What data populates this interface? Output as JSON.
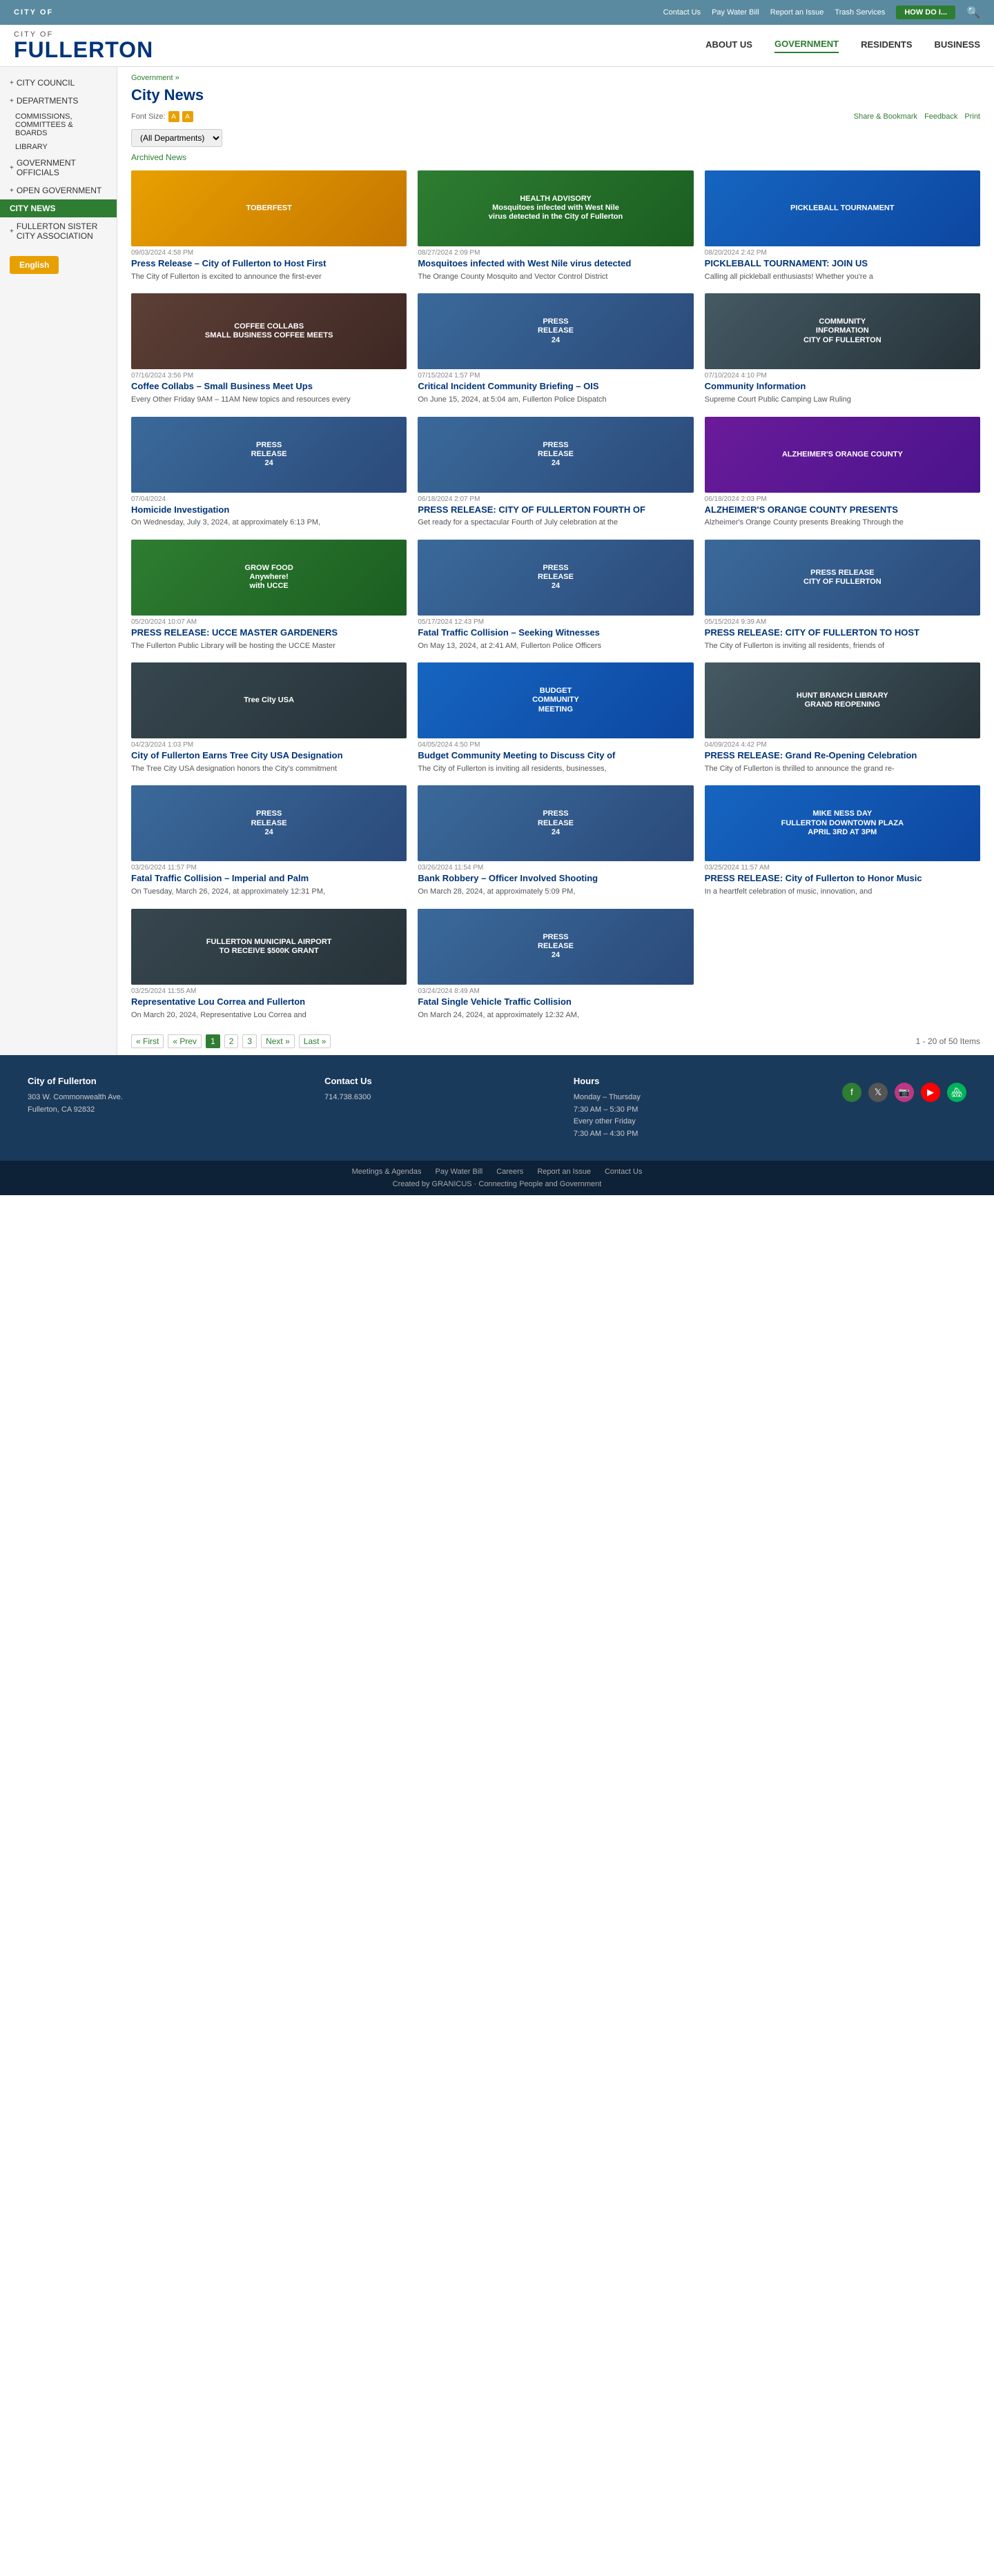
{
  "topbar": {
    "city_of": "CITY OF",
    "links": [
      "Contact Us",
      "Pay Water Bill",
      "Report an Issue",
      "Trash Services"
    ],
    "how_do_i": "HOW DO I...",
    "search_icon": "🔍"
  },
  "header": {
    "city_of": "CITY OF",
    "fullerton": "FULLERTON",
    "nav": [
      {
        "label": "ABOUT US",
        "active": false
      },
      {
        "label": "GOVERNMENT",
        "active": true
      },
      {
        "label": "RESIDENTS",
        "active": false
      },
      {
        "label": "BUSINESS",
        "active": false
      }
    ]
  },
  "sidebar": {
    "items": [
      {
        "label": "CITY COUNCIL",
        "expandable": true
      },
      {
        "label": "DEPARTMENTS",
        "expandable": true
      },
      {
        "label": "COMMISSIONS, COMMITTEES & BOARDS",
        "sub": true
      },
      {
        "label": "LIBRARY",
        "sub": true
      },
      {
        "label": "GOVERNMENT OFFICIALS",
        "expandable": true
      },
      {
        "label": "OPEN GOVERNMENT",
        "expandable": true
      },
      {
        "label": "CITY NEWS",
        "active": true
      },
      {
        "label": "FULLERTON SISTER CITY ASSOCIATION",
        "expandable": true
      }
    ],
    "lang_btn": "English"
  },
  "main": {
    "breadcrumb": "Government »",
    "title": "City News",
    "font_size_label": "Font Size:",
    "toolbar": {
      "share": "Share & Bookmark",
      "feedback": "Feedback",
      "print": "Print"
    },
    "filter": {
      "dept_label": "(All Departments)",
      "archived": "Archived News"
    },
    "news_items": [
      {
        "date": "09/03/2024 4:58 PM",
        "title": "Press Release – City of Fullerton to Host First",
        "excerpt": "The City of Fullerton is excited to announce the first-ever",
        "img_type": "toberfest",
        "img_label": "TOBERFEST"
      },
      {
        "date": "08/27/2024 2:09 PM",
        "title": "Mosquitoes infected with West Nile virus detected",
        "excerpt": "The Orange County Mosquito and Vector Control District",
        "img_type": "mosq",
        "img_label": "HEALTH ADVISORY\nMosquitoes infected with West Nile virus detected in the City of Fullerton"
      },
      {
        "date": "08/20/2024 2:42 PM",
        "title": "PICKLEBALL TOURNAMENT: JOIN US",
        "excerpt": "Calling all pickleball enthusiasts! Whether you're a",
        "img_type": "pickle",
        "img_label": "PICKLEBALL TOURNAMENT"
      },
      {
        "date": "07/16/2024 3:56 PM",
        "title": "Coffee Collabs – Small Business Meet Ups",
        "excerpt": "Every Other Friday 9AM – 11AM New topics and resources every",
        "img_type": "coffee",
        "img_label": "COFFEE COLLABS\nSMALL BUSINESS COFFEE MEETS"
      },
      {
        "date": "07/15/2024 1:57 PM",
        "title": "Critical Incident Community Briefing – OIS",
        "excerpt": "On June 15, 2024, at 5:04 am, Fullerton Police Dispatch",
        "img_type": "pr",
        "img_label": "PRESS\nRELEASE\n24"
      },
      {
        "date": "07/10/2024 4:10 PM",
        "title": "Community Information",
        "excerpt": "Supreme Court Public Camping Law Ruling",
        "img_type": "comm",
        "img_label": "COMMUNITY\nINFORMATION\nCITY OF FULLERTON"
      },
      {
        "date": "07/04/2024",
        "title": "Homicide Investigation",
        "excerpt": "On Wednesday, July 3, 2024, at approximately 6:13 PM,",
        "img_type": "pr",
        "img_label": "PRESS\nRELEASE\n24"
      },
      {
        "date": "06/18/2024 2:07 PM",
        "title": "PRESS RELEASE: CITY OF FULLERTON FOURTH OF",
        "excerpt": "Get ready for a spectacular Fourth of July celebration at the",
        "img_type": "pr",
        "img_label": "PRESS\nRELEASE\n24"
      },
      {
        "date": "06/18/2024 2:03 PM",
        "title": "ALZHEIMER'S ORANGE COUNTY PRESENTS",
        "excerpt": "Alzheimer's Orange County presents Breaking Through the",
        "img_type": "alz",
        "img_label": "ALZHEIMER'S ORANGE COUNTY"
      },
      {
        "date": "05/20/2024 10:07 AM",
        "title": "PRESS RELEASE: UCCE MASTER GARDENERS",
        "excerpt": "The Fullerton Public Library will be hosting the UCCE Master",
        "img_type": "grow",
        "img_label": "GROW FOOD\nAnywhere!\nwith UCCE"
      },
      {
        "date": "05/17/2024 12:43 PM",
        "title": "Fatal Traffic Collision – Seeking Witnesses",
        "excerpt": "On May 13, 2024, at 2:41 AM, Fullerton Police Officers",
        "img_type": "pr",
        "img_label": "PRESS\nRELEASE\n24"
      },
      {
        "date": "05/15/2024 9:39 AM",
        "title": "PRESS RELEASE: CITY OF FULLERTON TO HOST",
        "excerpt": "The City of Fullerton is inviting all residents, friends of",
        "img_type": "pr",
        "img_label": "PRESS RELEASE\nCITY OF FULLERTON"
      },
      {
        "date": "04/23/2024 1:03 PM",
        "title": "City of Fullerton Earns Tree City USA Designation",
        "excerpt": "The Tree City USA designation honors the City's commitment",
        "img_type": "tree",
        "img_label": "Tree City USA"
      },
      {
        "date": "04/05/2024 4:50 PM",
        "title": "Budget Community Meeting to Discuss City of",
        "excerpt": "The City of Fullerton is inviting all residents, businesses,",
        "img_type": "budget",
        "img_label": "BUDGET\nCOMMUNITY\nMEETING"
      },
      {
        "date": "04/09/2024 4:42 PM",
        "title": "PRESS RELEASE: Grand Re-Opening Celebration",
        "excerpt": "The City of Fullerton is thrilled to announce the grand re-",
        "img_type": "hunt",
        "img_label": "HUNT BRANCH LIBRARY\nGRAND REOPENING"
      },
      {
        "date": "03/26/2024 11:57 PM",
        "title": "Fatal Traffic Collision – Imperial and Palm",
        "excerpt": "On Tuesday, March 26, 2024, at approximately 12:31 PM,",
        "img_type": "pr",
        "img_label": "PRESS\nRELEASE\n24"
      },
      {
        "date": "03/26/2024 11:54 PM",
        "title": "Bank Robbery – Officer Involved Shooting",
        "excerpt": "On March 28, 2024, at approximately 5:09 PM,",
        "img_type": "pr",
        "img_label": "PRESS\nRELEASE\n24"
      },
      {
        "date": "03/25/2024 11:57 AM",
        "title": "PRESS RELEASE: City of Fullerton to Honor Music",
        "excerpt": "In a heartfelt celebration of music, innovation, and",
        "img_type": "mike",
        "img_label": "MIKE NESS DAY\nFULLERTON DOWNTOWN PLAZA\nAPRIL 3RD AT 3PM"
      },
      {
        "date": "03/25/2024 11:55 AM",
        "title": "Representative Lou Correa and Fullerton",
        "excerpt": "On March 20, 2024, Representative Lou Correa and",
        "img_type": "airport",
        "img_label": "FULLERTON MUNICIPAL AIRPORT TO RECEIVE $500K GRANT"
      },
      {
        "date": "03/24/2024 8:49 AM",
        "title": "Fatal Single Vehicle Traffic Collision",
        "excerpt": "On March 24, 2024, at approximately 12:32 AM,",
        "img_type": "pr",
        "img_label": "PRESS\nRELEASE\n24"
      }
    ],
    "pagination": {
      "first": "« First",
      "prev": "« Prev",
      "pages": [
        "1",
        "2",
        "3"
      ],
      "current": "1",
      "next": "Next »",
      "last": "Last »",
      "info": "1 - 20 of 50 Items"
    }
  },
  "footer": {
    "address": {
      "org": "City of Fullerton",
      "street": "303 W. Commonwealth Ave.",
      "city": "Fullerton, CA 92832"
    },
    "contact": {
      "label": "Contact Us",
      "phone": "714.738.6300"
    },
    "hours": {
      "label": "Hours",
      "weekdays": "Monday – Thursday",
      "weekday_hours": "7:30 AM – 5:30 PM",
      "friday": "Every other Friday",
      "friday_hours": "7:30 AM – 4:30 PM"
    },
    "social": [
      "f",
      "𝕏",
      "📷",
      "▶",
      "🔵"
    ],
    "bottom_links": [
      "Meetings & Agendas",
      "Pay Water Bill",
      "Careers",
      "Report an Issue",
      "Contact Us"
    ],
    "granicus": "Created by GRANICUS · Connecting People and Government"
  }
}
